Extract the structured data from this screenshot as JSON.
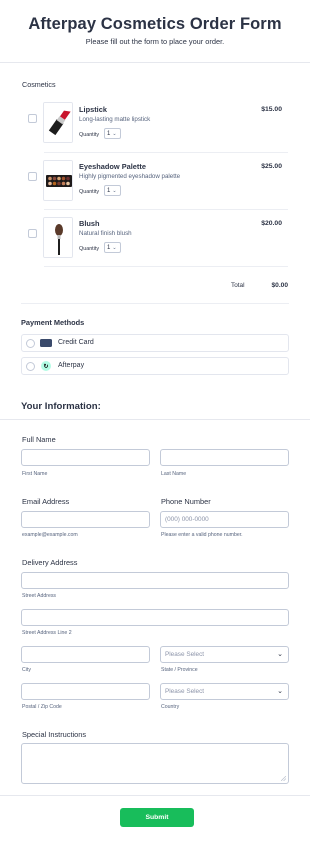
{
  "header": {
    "title": "Afterpay Cosmetics Order Form",
    "subtitle": "Please fill out the form to place your order."
  },
  "products": {
    "section_label": "Cosmetics",
    "items": [
      {
        "name": "Lipstick",
        "description": "Long-lasting matte lipstick",
        "price": "$15.00",
        "quantity_label": "Quantity",
        "quantity": "1",
        "icon": "lipstick-image"
      },
      {
        "name": "Eyeshadow Palette",
        "description": "Highly pigmented eyeshadow palette",
        "price": "$25.00",
        "quantity_label": "Quantity",
        "quantity": "1",
        "icon": "eyeshadow-palette-image"
      },
      {
        "name": "Blush",
        "description": "Natural finish blush",
        "price": "$20.00",
        "quantity_label": "Quantity",
        "quantity": "1",
        "icon": "blush-brush-image"
      }
    ],
    "total_label": "Total",
    "total_value": "$0.00"
  },
  "payment": {
    "label": "Payment Methods",
    "options": [
      {
        "label": "Credit Card",
        "icon": "credit-card-icon"
      },
      {
        "label": "Afterpay",
        "icon": "afterpay-icon"
      }
    ]
  },
  "info": {
    "heading": "Your Information:",
    "full_name": {
      "label": "Full Name",
      "first_sublabel": "First Name",
      "last_sublabel": "Last Name"
    },
    "email": {
      "label": "Email Address",
      "sublabel": "example@example.com"
    },
    "phone": {
      "label": "Phone Number",
      "placeholder": "(000) 000-0000",
      "sublabel": "Please enter a valid phone number."
    },
    "address": {
      "label": "Delivery Address",
      "street_sublabel": "Street Address",
      "street2_sublabel": "Street Address Line 2",
      "city_sublabel": "City",
      "state_sublabel": "State / Province",
      "state_placeholder": "Please Select",
      "postal_sublabel": "Postal / Zip Code",
      "country_sublabel": "Country",
      "country_placeholder": "Please Select"
    },
    "special": {
      "label": "Special Instructions"
    }
  },
  "submit_label": "Submit",
  "colors": {
    "accent": "#18bd5b",
    "text": "#2c3345",
    "border": "#c3cad8",
    "afterpay": "#b2fce4"
  }
}
